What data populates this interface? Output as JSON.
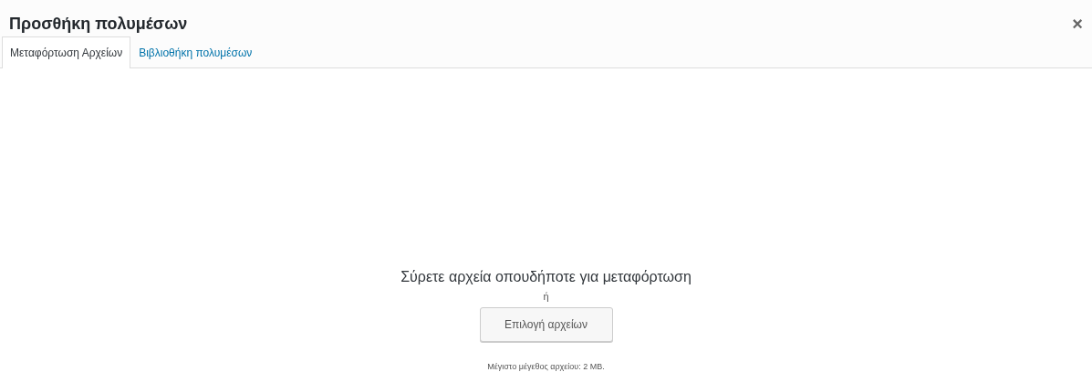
{
  "window": {
    "title": "Προσθήκη πολυμέσων",
    "close": "×"
  },
  "tabs": [
    {
      "label": "Μεταφόρτωση Αρχείων",
      "selected": true
    },
    {
      "label": "Βιβλιοθήκη πολυμέσων",
      "selected": false
    }
  ],
  "uploader": {
    "instructions": "Σύρετε αρχεία οπουδήποτε για μεταφόρτωση",
    "or": "ή",
    "button": "Επιλογή αρχείων",
    "max_size": "Μέγιστο μέγεθος αρχείου: 2 MB."
  }
}
